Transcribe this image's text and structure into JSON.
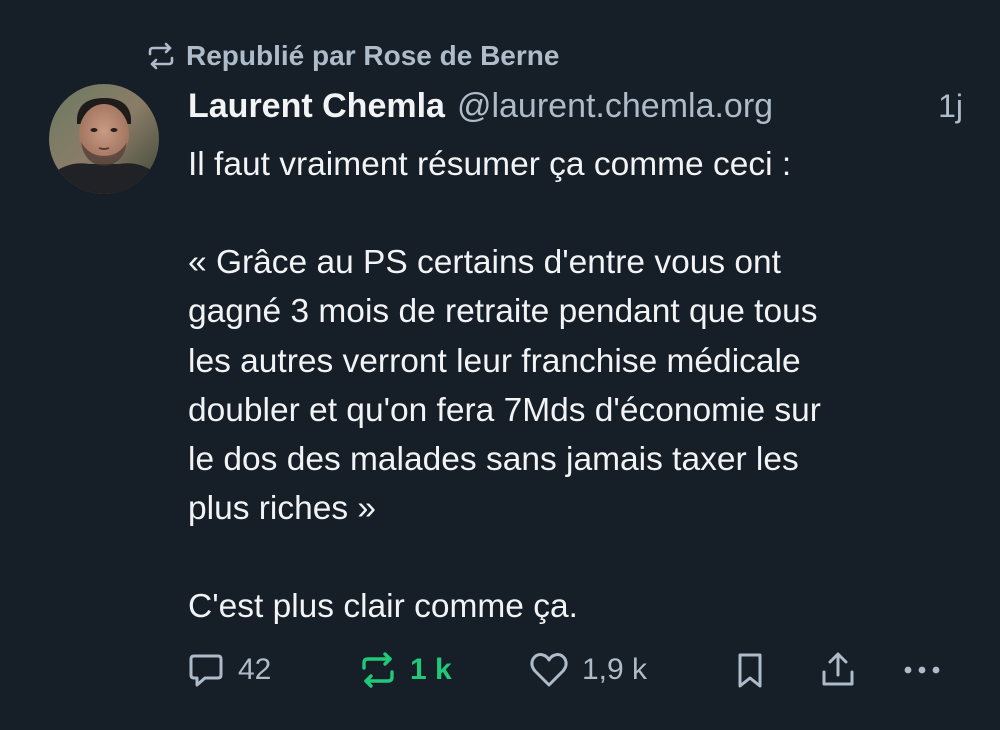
{
  "repost": {
    "icon": "repost-icon",
    "label": "Republié par Rose de Berne"
  },
  "post": {
    "author_name": "Laurent Chemla",
    "author_handle": "@laurent.chemla.org",
    "time": "1j",
    "paragraphs": [
      "Il faut vraiment résumer ça comme ceci :",
      "« Grâce au PS certains d'entre vous ont\ngagné 3 mois de retraite pendant que tous\nles autres verront leur franchise médicale\ndoubler et qu'on fera 7Mds d'économie sur\nle dos des malades sans jamais taxer les\nplus riches »",
      "C'est plus clair comme ça."
    ]
  },
  "actions": {
    "reply": {
      "icon": "reply-icon",
      "count": "42"
    },
    "repost": {
      "icon": "repost-icon",
      "count": "1 k",
      "active_color": "#20c97a"
    },
    "like": {
      "icon": "heart-icon",
      "count": "1,9 k"
    },
    "bookmark": {
      "icon": "bookmark-icon"
    },
    "share": {
      "icon": "share-icon"
    },
    "more": {
      "icon": "more-icon"
    }
  },
  "colors": {
    "background": "#161e27",
    "text": "#f1f3f5",
    "muted": "#aebbc9",
    "accent_repost": "#20c97a"
  }
}
